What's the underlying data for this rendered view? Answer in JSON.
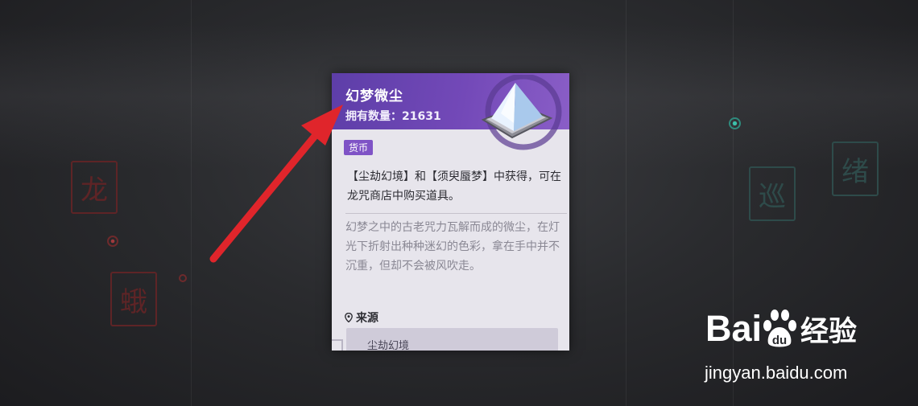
{
  "item": {
    "name": "幻梦微尘",
    "owned": "拥有数量：21631",
    "tag": "货币",
    "description": "【尘劫幻境】和【须臾蜃梦】中获得，可在龙咒商店中购买道具。",
    "lore": "幻梦之中的古老咒力瓦解而成的微尘，在灯光下折射出种种迷幻的色彩，拿在手中并不沉重，但却不会被风吹走。",
    "source_heading": "来源",
    "sources": [
      "尘劫幻境"
    ]
  },
  "background": {
    "seals_left": [
      "龙",
      "蛾"
    ],
    "seals_right": [
      "巡",
      "绪"
    ]
  },
  "watermark": {
    "brand": "Bai",
    "brand_suffix": "du",
    "brand_cn": "经验",
    "url": "jingyan.baidu.com"
  },
  "colors": {
    "header": "#6b44b3",
    "tag": "#7f53c6",
    "arrow": "#e0252b",
    "card_bg": "#e7e5ec"
  }
}
